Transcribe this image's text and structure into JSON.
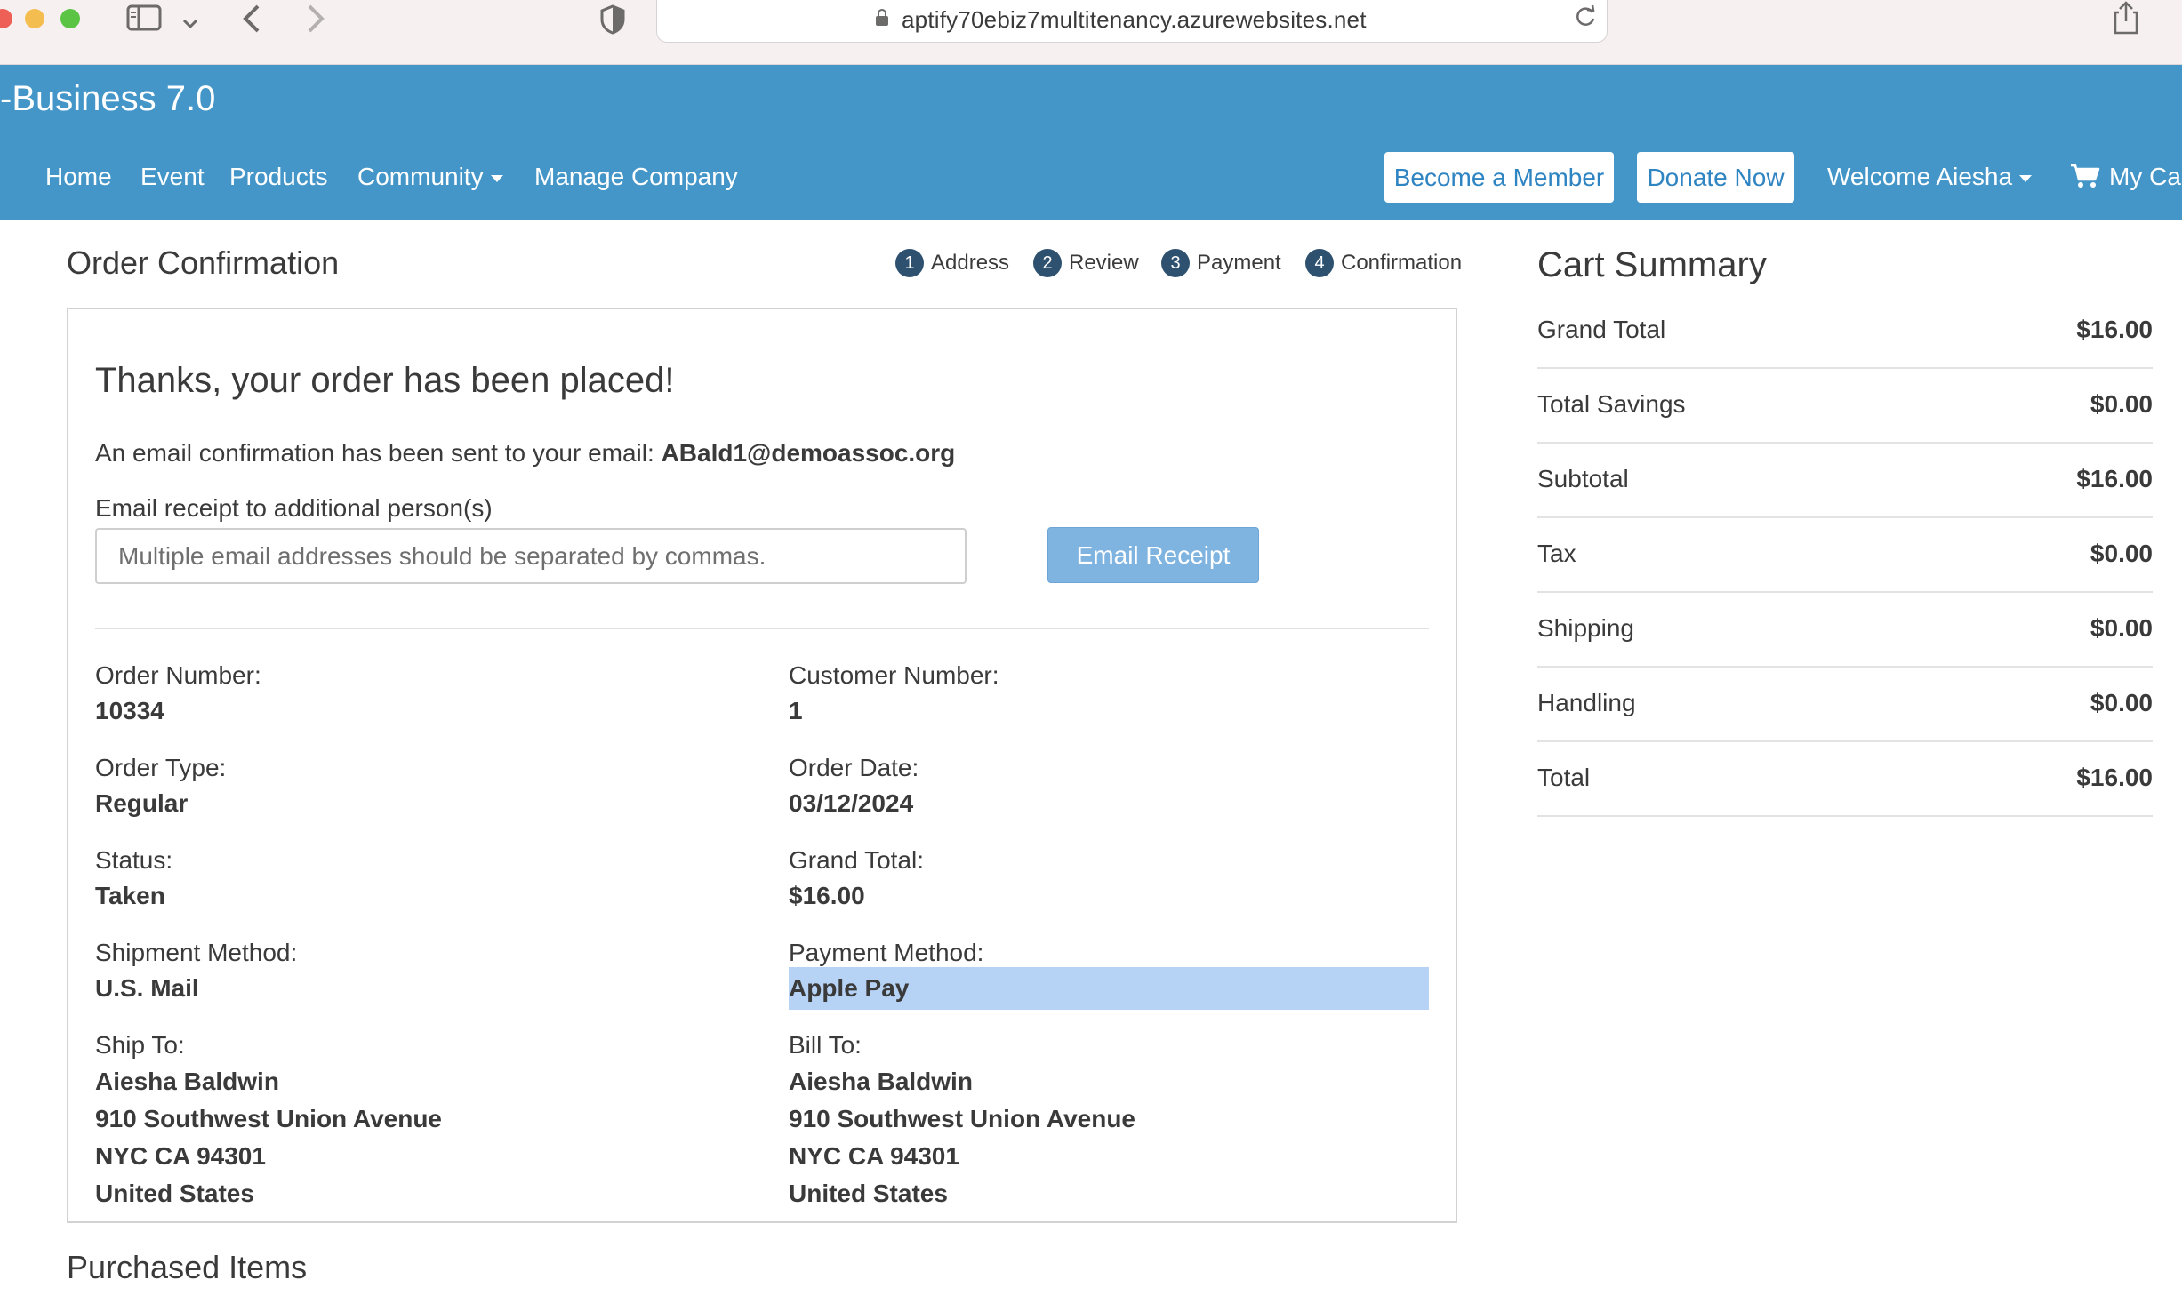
{
  "browser": {
    "url": "aptify70ebiz7multitenancy.azurewebsites.net"
  },
  "header": {
    "brand": "-Business 7.0",
    "nav": {
      "home": "Home",
      "event": "Event",
      "products": "Products",
      "community": "Community",
      "manage_company": "Manage Company",
      "welcome": "Welcome Aiesha",
      "cart": "My Ca"
    },
    "buttons": {
      "become_member": "Become a Member",
      "donate_now": "Donate Now"
    },
    "colors": {
      "header_bg": "#4496c9",
      "button_text": "#2f84c2"
    }
  },
  "main": {
    "title": "Order Confirmation",
    "steps": [
      {
        "num": "1",
        "label": "Address"
      },
      {
        "num": "2",
        "label": "Review"
      },
      {
        "num": "3",
        "label": "Payment"
      },
      {
        "num": "4",
        "label": "Confirmation"
      }
    ],
    "panel": {
      "thanks": "Thanks, your order has been placed!",
      "email_sent_text": "An email confirmation has been sent to your email:",
      "email": "ABald1@demoassoc.org",
      "receipt_label": "Email receipt to additional person(s)",
      "receipt_placeholder": "Multiple email addresses should be separated by commas.",
      "receipt_button": "Email Receipt"
    },
    "details": {
      "order_number": {
        "label": "Order Number:",
        "value": "10334"
      },
      "customer_number": {
        "label": "Customer Number:",
        "value": "1"
      },
      "order_type": {
        "label": "Order Type:",
        "value": "Regular"
      },
      "order_date": {
        "label": "Order Date:",
        "value": "03/12/2024"
      },
      "status": {
        "label": "Status:",
        "value": "Taken"
      },
      "grand_total": {
        "label": "Grand Total:",
        "value": "$16.00"
      },
      "shipment_method": {
        "label": "Shipment Method:",
        "value": "U.S. Mail"
      },
      "payment_method": {
        "label": "Payment Method:",
        "value": "Apple Pay"
      },
      "ship_to": {
        "label": "Ship To:",
        "lines": [
          "Aiesha Baldwin",
          "910 Southwest Union Avenue",
          "NYC CA 94301",
          "United States"
        ]
      },
      "bill_to": {
        "label": "Bill To:",
        "lines": [
          "Aiesha Baldwin",
          "910 Southwest Union Avenue",
          "NYC CA 94301",
          "United States"
        ]
      }
    },
    "purchased_items": "Purchased Items"
  },
  "cart_summary": {
    "title": "Cart Summary",
    "rows": [
      {
        "label": "Grand Total",
        "value": "$16.00"
      },
      {
        "label": "Total Savings",
        "value": "$0.00"
      },
      {
        "label": "Subtotal",
        "value": "$16.00"
      },
      {
        "label": "Tax",
        "value": "$0.00"
      },
      {
        "label": "Shipping",
        "value": "$0.00"
      },
      {
        "label": "Handling",
        "value": "$0.00"
      },
      {
        "label": "Total",
        "value": "$16.00"
      }
    ]
  }
}
